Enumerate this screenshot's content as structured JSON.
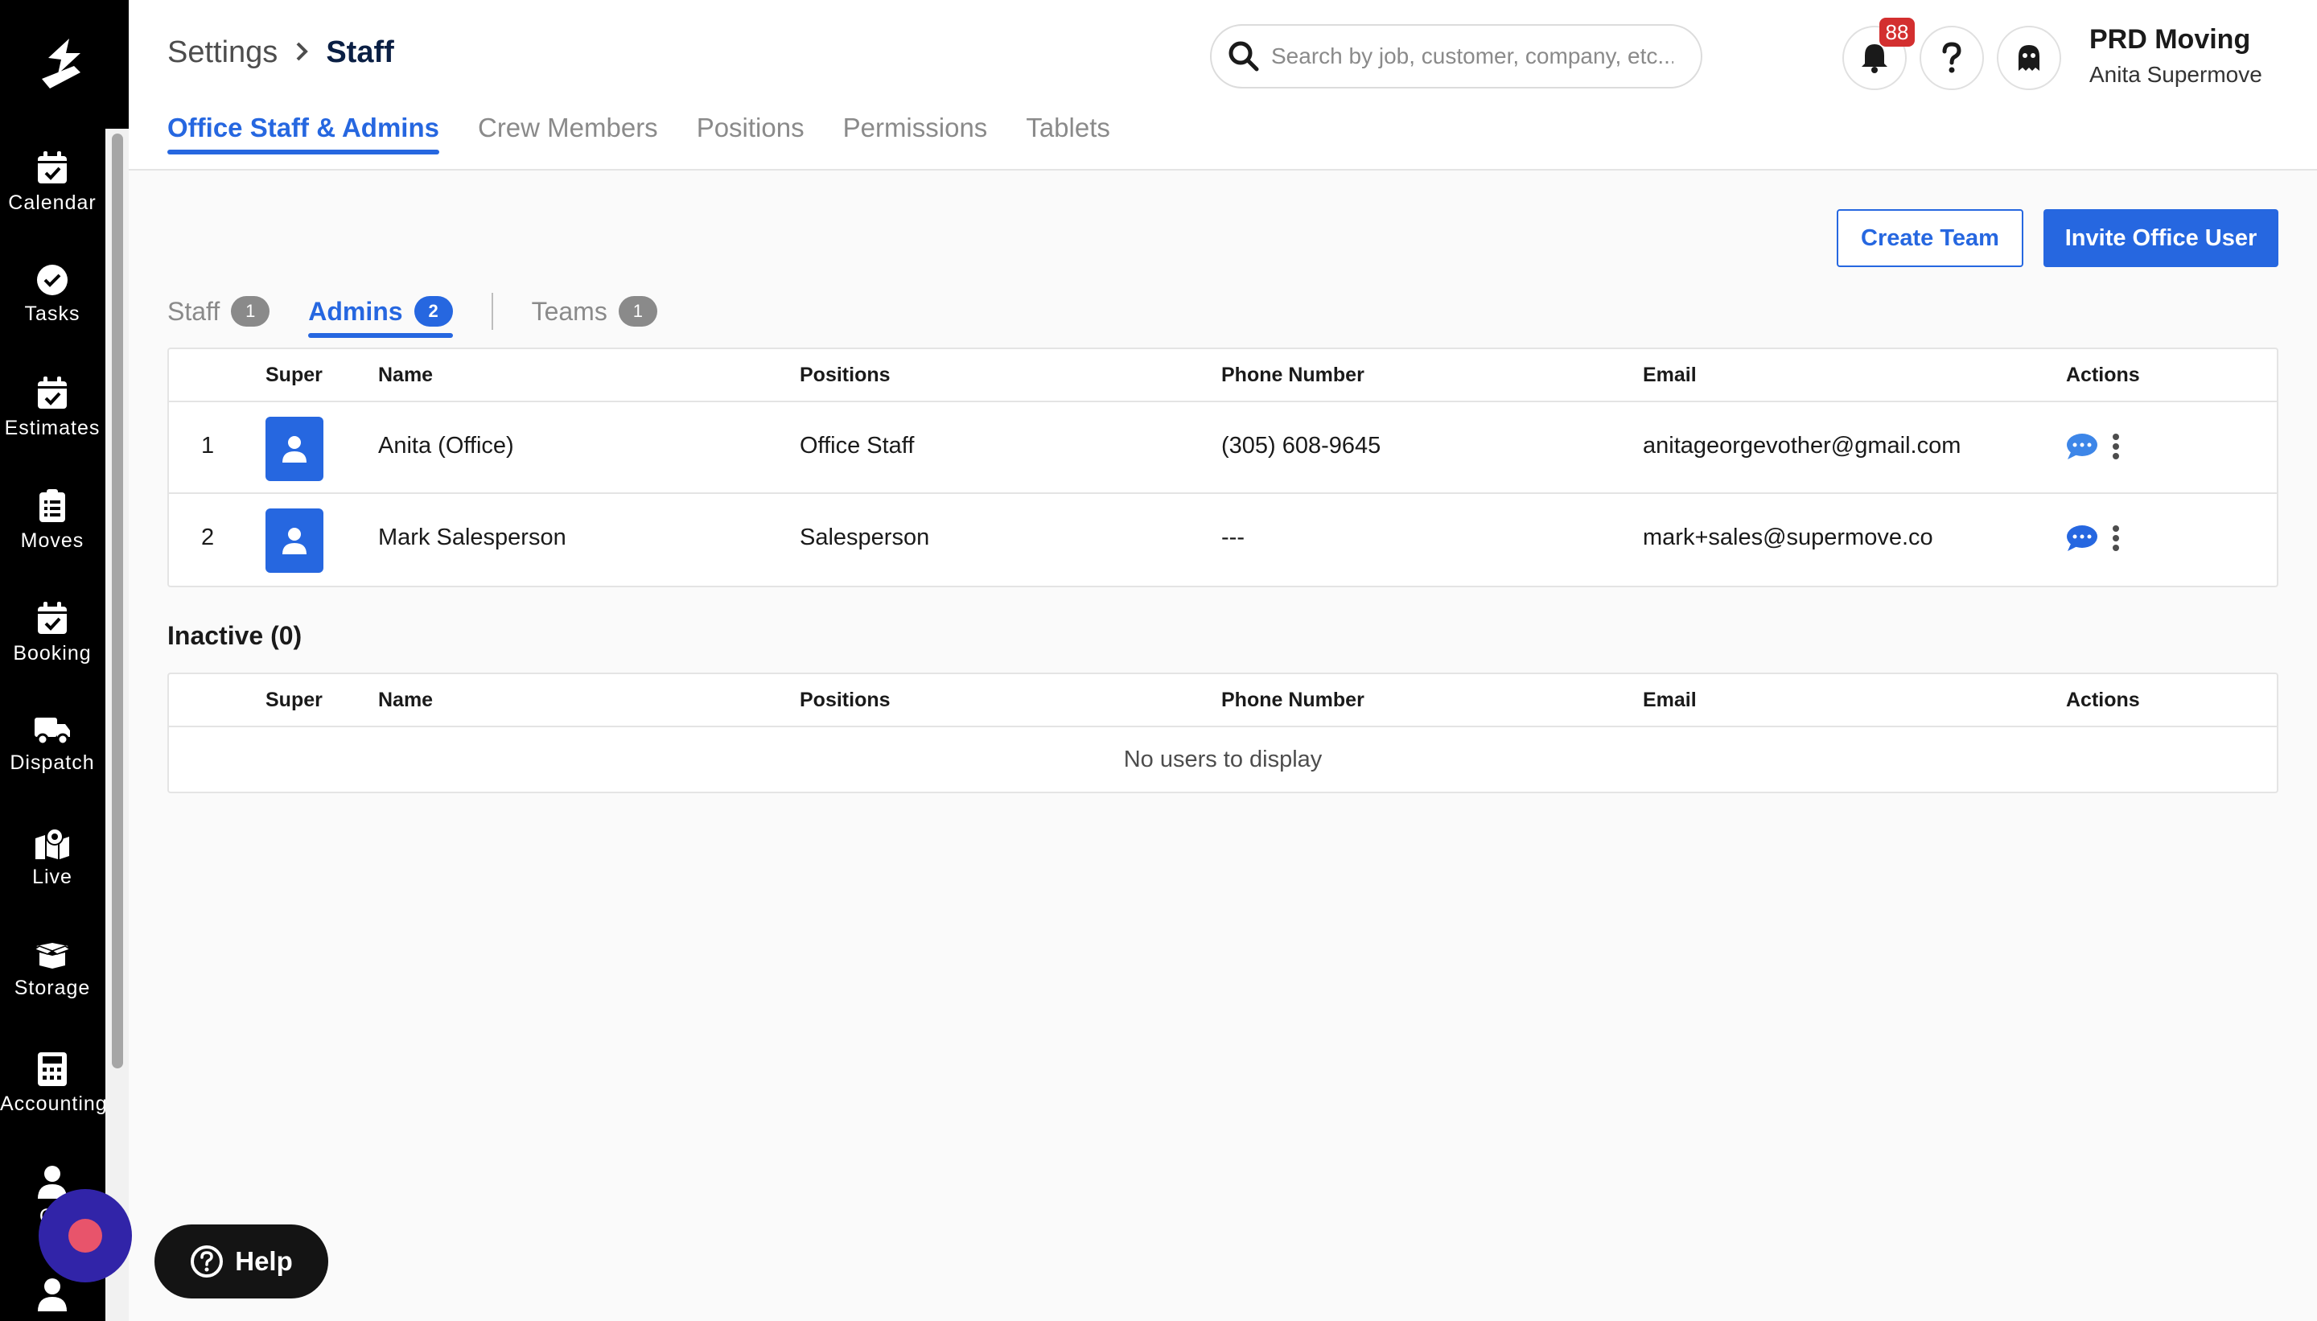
{
  "breadcrumb": {
    "parent": "Settings",
    "current": "Staff"
  },
  "search": {
    "placeholder": "Search by job, customer, company, etc..."
  },
  "notifications": {
    "count": "88"
  },
  "org": {
    "name": "PRD Moving",
    "user": "Anita Supermove"
  },
  "sidebar": {
    "items": [
      {
        "label": "Calendar",
        "icon": "calendar-check-icon"
      },
      {
        "label": "Tasks",
        "icon": "check-circle-icon"
      },
      {
        "label": "Estimates",
        "icon": "calendar-check-icon"
      },
      {
        "label": "Moves",
        "icon": "clipboard-list-icon"
      },
      {
        "label": "Booking",
        "icon": "calendar-check-icon"
      },
      {
        "label": "Dispatch",
        "icon": "truck-icon"
      },
      {
        "label": "Live",
        "icon": "map-marker-icon"
      },
      {
        "label": "Storage",
        "icon": "box-open-icon"
      },
      {
        "label": "Accounting",
        "icon": "calculator-icon"
      },
      {
        "label": "Cli",
        "icon": "user-icon"
      },
      {
        "label": "",
        "icon": "user-icon"
      }
    ]
  },
  "tabs": [
    {
      "label": "Office Staff & Admins",
      "active": true
    },
    {
      "label": "Crew Members",
      "active": false
    },
    {
      "label": "Positions",
      "active": false
    },
    {
      "label": "Permissions",
      "active": false
    },
    {
      "label": "Tablets",
      "active": false
    }
  ],
  "buttons": {
    "create_team": "Create Team",
    "invite_office_user": "Invite Office User"
  },
  "subtabs": [
    {
      "label": "Staff",
      "count": "1",
      "active": false
    },
    {
      "label": "Admins",
      "count": "2",
      "active": true
    },
    {
      "label": "Teams",
      "count": "1",
      "active": false
    }
  ],
  "table": {
    "columns": [
      "Super",
      "Name",
      "Positions",
      "Phone Number",
      "Email",
      "Actions"
    ],
    "rows": [
      {
        "index": "1",
        "name": "Anita (Office)",
        "position": "Office Staff",
        "phone": "(305) 608-9645",
        "email": "anitageorgevother@gmail.com"
      },
      {
        "index": "2",
        "name": "Mark Salesperson",
        "position": "Salesperson",
        "phone": "---",
        "email": "mark+sales@supermove.co"
      }
    ]
  },
  "inactive": {
    "title": "Inactive (0)",
    "columns": [
      "Super",
      "Name",
      "Positions",
      "Phone Number",
      "Email",
      "Actions"
    ],
    "empty_text": "No users to display"
  },
  "help": {
    "label": "Help"
  },
  "colors": {
    "accent": "#2667e0",
    "sidebar": "#000000",
    "badge": "#d32f2f",
    "fab": "#3124a8"
  }
}
